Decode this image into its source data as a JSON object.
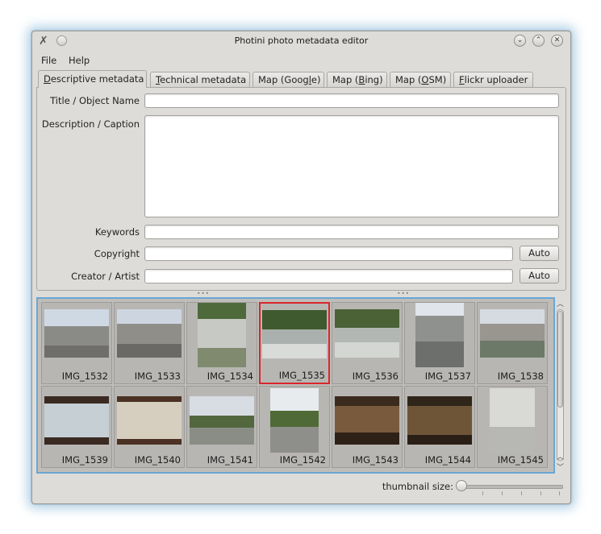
{
  "window": {
    "title": "Photini photo metadata editor",
    "buttons": {
      "minimize": "⌄",
      "maximize": "⌃",
      "close": "✕"
    }
  },
  "menu": {
    "items": [
      "File",
      "Help"
    ]
  },
  "tabs": [
    {
      "label": "Descriptive metadata",
      "active": true
    },
    {
      "label": "Technical metadata",
      "active": false
    },
    {
      "label": "Map (Google)",
      "active": false
    },
    {
      "label": "Map (Bing)",
      "active": false
    },
    {
      "label": "Map (OSM)",
      "active": false
    },
    {
      "label": "Flickr uploader",
      "active": false
    }
  ],
  "form": {
    "title_label": "Title / Object Name",
    "title_value": "",
    "description_label": "Description / Caption",
    "description_value": "",
    "keywords_label": "Keywords",
    "keywords_value": "",
    "copyright_label": "Copyright",
    "copyright_value": "",
    "copyright_auto": "Auto",
    "creator_label": "Creator / Artist",
    "creator_value": "",
    "creator_auto": "Auto"
  },
  "thumbnails": [
    {
      "name": "IMG_1532",
      "selected": false
    },
    {
      "name": "IMG_1533",
      "selected": false
    },
    {
      "name": "IMG_1534",
      "selected": false
    },
    {
      "name": "IMG_1535",
      "selected": true
    },
    {
      "name": "IMG_1536",
      "selected": false
    },
    {
      "name": "IMG_1537",
      "selected": false
    },
    {
      "name": "IMG_1538",
      "selected": false
    },
    {
      "name": "IMG_1539",
      "selected": false
    },
    {
      "name": "IMG_1540",
      "selected": false
    },
    {
      "name": "IMG_1541",
      "selected": false
    },
    {
      "name": "IMG_1542",
      "selected": false
    },
    {
      "name": "IMG_1543",
      "selected": false
    },
    {
      "name": "IMG_1544",
      "selected": false
    },
    {
      "name": "IMG_1545",
      "selected": false
    }
  ],
  "thumbnail_size": {
    "label": "thumbnail size:",
    "value": 0
  }
}
